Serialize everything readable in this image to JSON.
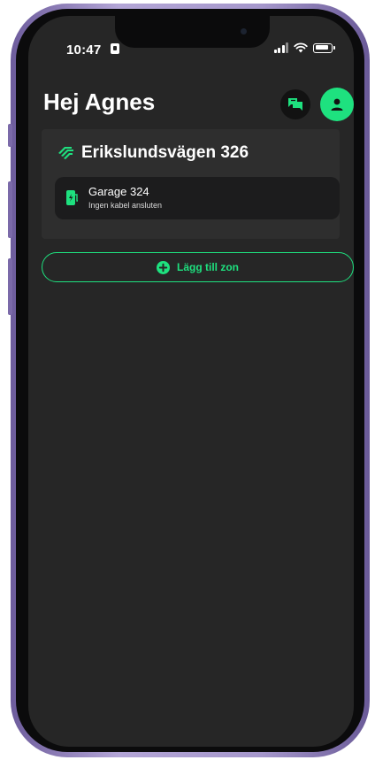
{
  "status_bar": {
    "time": "10:47"
  },
  "header": {
    "greeting": "Hej Agnes"
  },
  "site": {
    "name": "Erikslundsvägen 326",
    "zones": [
      {
        "name": "Garage 324",
        "status": "Ingen kabel ansluten",
        "icon": "ev-charger-icon"
      }
    ]
  },
  "actions": {
    "add_zone_label": "Lägg till zon"
  },
  "icons": {
    "chat": "chat-icon",
    "profile": "user-icon",
    "site": "location-tag-icon",
    "add": "plus-circle-icon"
  },
  "colors": {
    "accent": "#1ee17f",
    "background": "#262626",
    "card": "#2e2e2e",
    "zone_row": "#1c1c1d",
    "device_frame": "#a597cb"
  }
}
